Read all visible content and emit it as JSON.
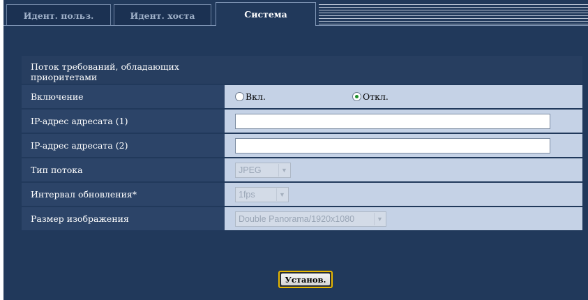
{
  "tabs": {
    "user_auth": "Идент. польз.",
    "host_auth": "Идент. хоста",
    "system": "Система"
  },
  "panel": {
    "header": "Поток требований, обладающих приоритетами"
  },
  "rows": {
    "enable": {
      "label": "Включение",
      "on_label": "Вкл.",
      "off_label": "Откл.",
      "selected": "off"
    },
    "dest_ip_1": {
      "label": "IP-адрес адресата (1)",
      "value": ""
    },
    "dest_ip_2": {
      "label": "IP-адрес адресата (2)",
      "value": ""
    },
    "stream_type": {
      "label": "Тип потока",
      "value": "JPEG"
    },
    "refresh_interval": {
      "label": "Интервал обновления*",
      "value": "1fps"
    },
    "image_size": {
      "label": "Размер изображения",
      "value": "Double Panorama/1920x1080"
    }
  },
  "buttons": {
    "set": "Установ."
  },
  "colors": {
    "background": "#21395b",
    "value_cell": "#c5d2e6",
    "button_border": "#e8b800"
  }
}
